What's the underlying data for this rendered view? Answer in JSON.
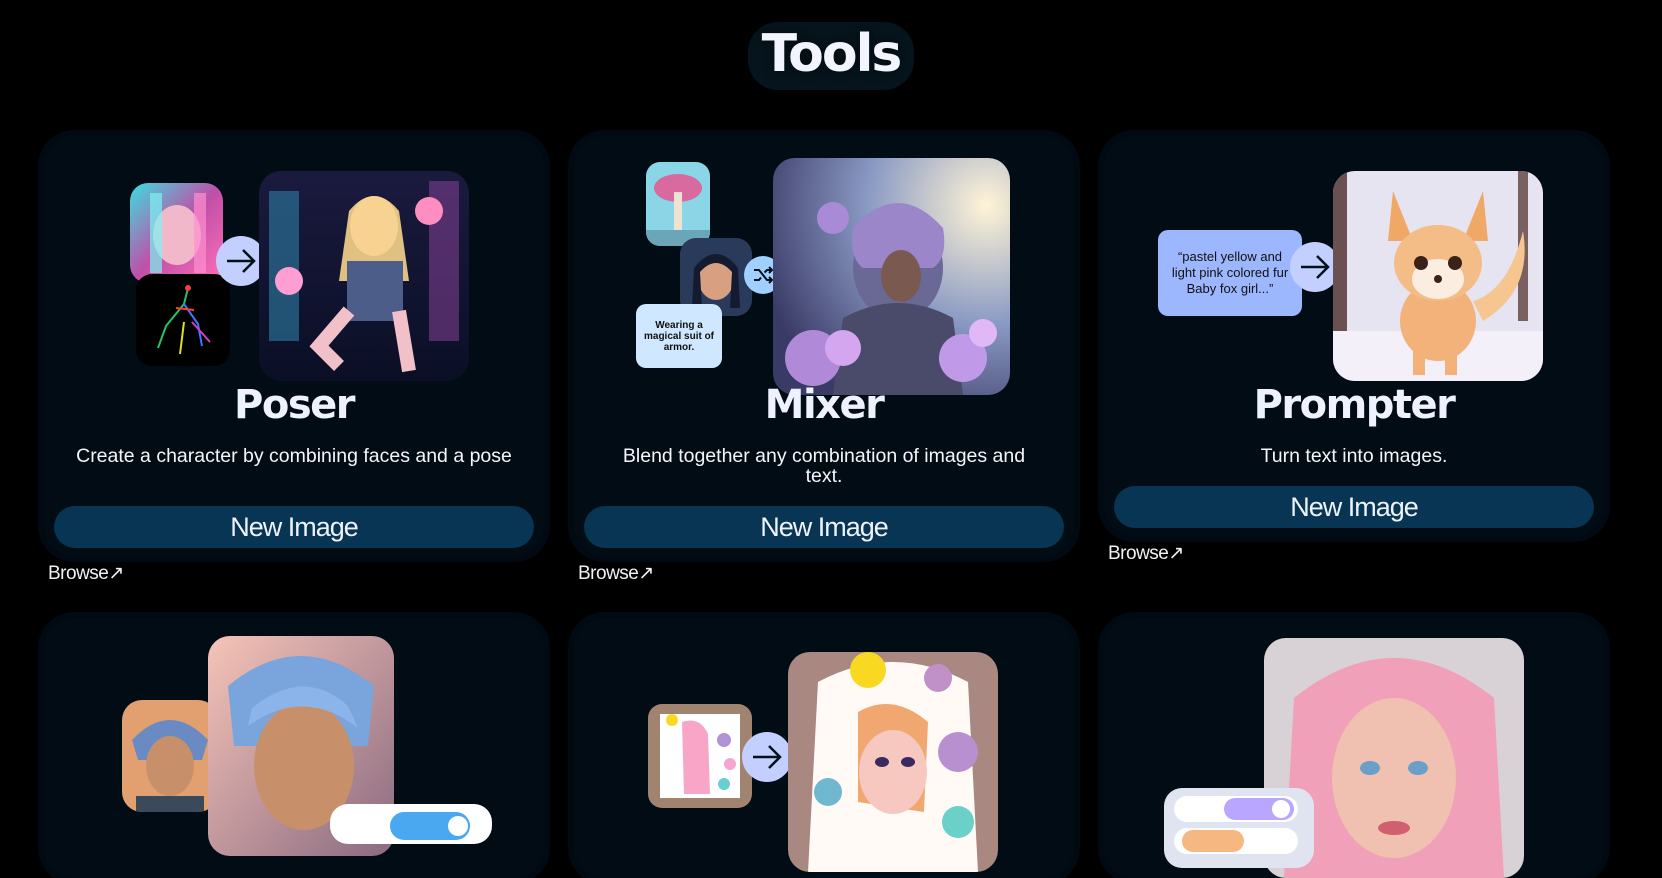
{
  "page": {
    "title": "Tools"
  },
  "tools": [
    {
      "name": "Poser",
      "description": "Create a character by combining faces and a pose",
      "button_label": "New Image",
      "browse_label": "Browse↗"
    },
    {
      "name": "Mixer",
      "description": "Blend together any combination of images and text.",
      "button_label": "New Image",
      "browse_label": "Browse↗",
      "bubble_text": "Wearing a magical suit of armor."
    },
    {
      "name": "Prompter",
      "description": "Turn text into images.",
      "button_label": "New Image",
      "browse_label": "Browse↗",
      "bubble_text": "“pastel yellow and light pink colored fur Baby fox girl...”"
    }
  ],
  "colors": {
    "background": "#000000",
    "card": "#020c14",
    "button": "#073553",
    "arrow_circle": "#c3cfff",
    "bubble_blue": "#9db7ff",
    "bubble_light": "#cfe8ff",
    "accent_toggle": "#4aa8f0",
    "accent_purple": "#b8a6ff"
  },
  "icons": [
    "arrow-right-icon",
    "shuffle-icon",
    "browse-external-icon"
  ]
}
